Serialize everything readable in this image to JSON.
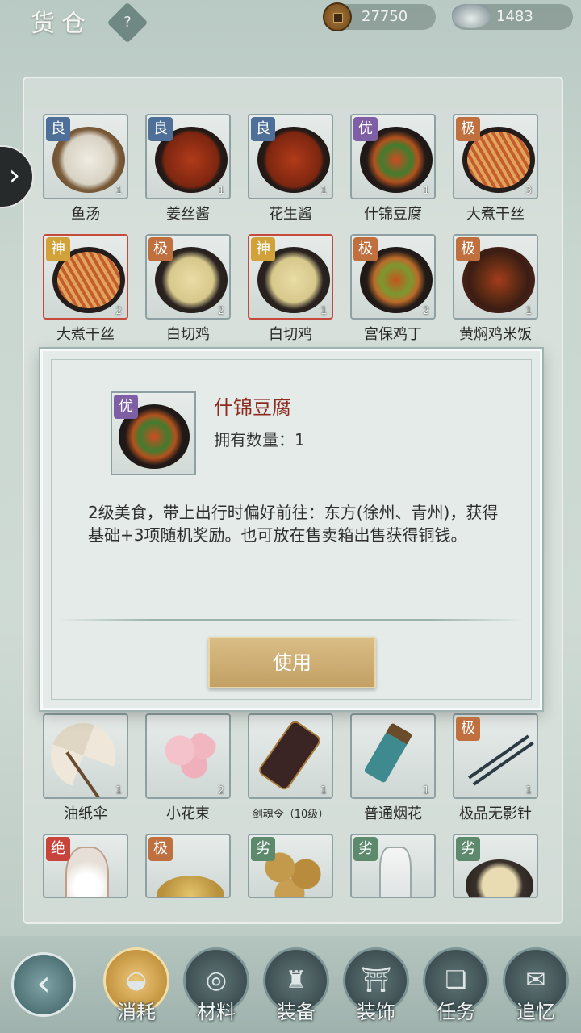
{
  "header": {
    "title": "货仓",
    "help_label": "?",
    "copper": "27750",
    "silver": "1483"
  },
  "items": [
    {
      "name": "鱼汤",
      "grade": "良",
      "qty": "1"
    },
    {
      "name": "姜丝酱",
      "grade": "良",
      "qty": "1"
    },
    {
      "name": "花生酱",
      "grade": "良",
      "qty": "1"
    },
    {
      "name": "什锦豆腐",
      "grade": "优",
      "qty": "1"
    },
    {
      "name": "大煮干丝",
      "grade": "极",
      "qty": "3"
    },
    {
      "name": "大煮干丝",
      "grade": "神",
      "qty": "2"
    },
    {
      "name": "白切鸡",
      "grade": "极",
      "qty": "2"
    },
    {
      "name": "白切鸡",
      "grade": "神",
      "qty": "1"
    },
    {
      "name": "宫保鸡丁",
      "grade": "极",
      "qty": "2"
    },
    {
      "name": "黄焖鸡米饭",
      "grade": "极",
      "qty": "1"
    },
    {
      "name": "油纸伞",
      "grade": "",
      "qty": "1"
    },
    {
      "name": "小花束",
      "grade": "",
      "qty": "2"
    },
    {
      "name": "剑魂令（10级）",
      "grade": "",
      "qty": "1"
    },
    {
      "name": "普通烟花",
      "grade": "",
      "qty": "1"
    },
    {
      "name": "极品无影针",
      "grade": "极",
      "qty": "1"
    },
    {
      "name": "",
      "grade": "绝",
      "qty": ""
    },
    {
      "name": "",
      "grade": "极",
      "qty": ""
    },
    {
      "name": "",
      "grade": "劣",
      "qty": ""
    },
    {
      "name": "",
      "grade": "劣",
      "qty": ""
    },
    {
      "name": "",
      "grade": "劣",
      "qty": ""
    }
  ],
  "dialog": {
    "grade": "优",
    "title": "什锦豆腐",
    "owned_label": "拥有数量：",
    "owned_value": "1",
    "description": "2级美食，带上出行时偏好前往：东方(徐州、青州)，获得基础+3项随机奖励。也可放在售卖箱出售获得铜钱。",
    "use_label": "使用"
  },
  "nav": {
    "back_icon": "back-arrow-icon",
    "tabs": [
      {
        "label": "消耗",
        "icon": "bowl-icon",
        "active": true
      },
      {
        "label": "材料",
        "icon": "logs-icon",
        "active": false
      },
      {
        "label": "装备",
        "icon": "robe-icon",
        "active": false
      },
      {
        "label": "装饰",
        "icon": "gate-icon",
        "active": false
      },
      {
        "label": "任务",
        "icon": "scroll-icon",
        "active": false
      },
      {
        "label": "追忆",
        "icon": "letter-icon",
        "active": false
      }
    ]
  }
}
